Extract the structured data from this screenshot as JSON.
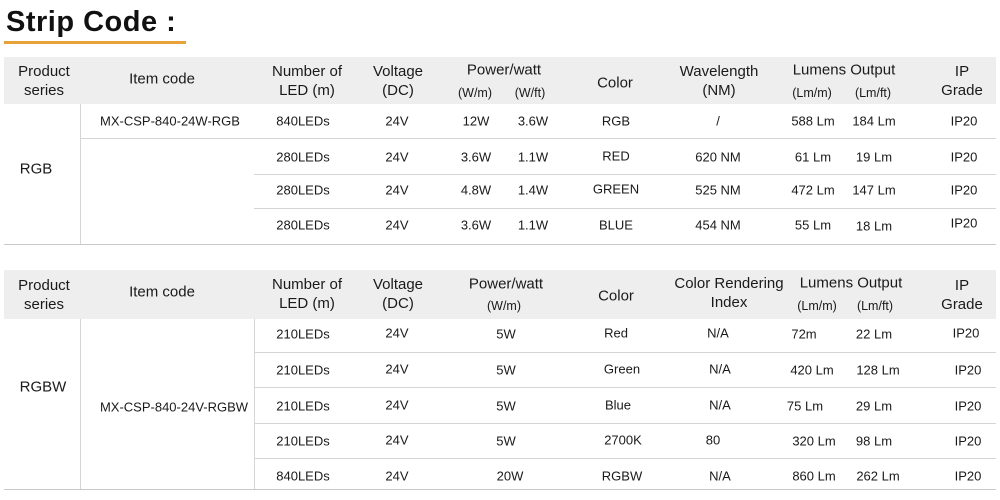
{
  "title": "Strip Code :",
  "table1": {
    "headers": {
      "product_series": [
        "Product",
        "series"
      ],
      "item_code": "Item code",
      "led": [
        "Number of",
        "LED (m)"
      ],
      "voltage": [
        "Voltage",
        "(DC)"
      ],
      "power": "Power/watt",
      "power_w_m": "(W/m)",
      "power_w_ft": "(W/ft)",
      "color": "Color",
      "wavelength": [
        "Wavelength",
        "(NM)"
      ],
      "lumens": "Lumens Output",
      "lumens_m": "(Lm/m)",
      "lumens_ft": "(Lm/ft)",
      "ip": [
        "IP",
        "Grade"
      ]
    },
    "series_name": "RGB",
    "item_code": "MX-CSP-840-24W-RGB",
    "rows": [
      {
        "led": "840LEDs",
        "voltage": "24V",
        "w_m": "12W",
        "w_ft": "3.6W",
        "color": "RGB",
        "wavelength": "/",
        "lm_m": "588 Lm",
        "lm_ft": "184 Lm",
        "ip": "IP20"
      },
      {
        "led": "280LEDs",
        "voltage": "24V",
        "w_m": "3.6W",
        "w_ft": "1.1W",
        "color": "RED",
        "wavelength": "620 NM",
        "lm_m": "61 Lm",
        "lm_ft": "19 Lm",
        "ip": "IP20"
      },
      {
        "led": "280LEDs",
        "voltage": "24V",
        "w_m": "4.8W",
        "w_ft": "1.4W",
        "color": "GREEN",
        "wavelength": "525 NM",
        "lm_m": "472 Lm",
        "lm_ft": "147 Lm",
        "ip": "IP20"
      },
      {
        "led": "280LEDs",
        "voltage": "24V",
        "w_m": "3.6W",
        "w_ft": "1.1W",
        "color": "BLUE",
        "wavelength": "454 NM",
        "lm_m": "55 Lm",
        "lm_ft": "18 Lm",
        "ip": "IP20"
      }
    ]
  },
  "table2": {
    "headers": {
      "product_series": [
        "Product",
        "series"
      ],
      "item_code": "Item code",
      "led": [
        "Number of",
        "LED (m)"
      ],
      "voltage": [
        "Voltage",
        "(DC)"
      ],
      "power": "Power/watt",
      "power_unit": "(W/m)",
      "color": "Color",
      "cri": [
        "Color Rendering",
        "Index"
      ],
      "lumens": "Lumens Output",
      "lumens_m": "(Lm/m)",
      "lumens_ft": "(Lm/ft)",
      "ip": [
        "IP",
        "Grade"
      ]
    },
    "series_name": "RGBW",
    "item_code": "MX-CSP-840-24V-RGBW",
    "rows": [
      {
        "led": "210LEDs",
        "voltage": "24V",
        "power": "5W",
        "color": "Red",
        "cri": "N/A",
        "lm_m": "72m",
        "lm_ft": "22 Lm",
        "ip": "IP20"
      },
      {
        "led": "210LEDs",
        "voltage": "24V",
        "power": "5W",
        "color": "Green",
        "cri": "N/A",
        "lm_m": "420 Lm",
        "lm_ft": "128 Lm",
        "ip": "IP20"
      },
      {
        "led": "210LEDs",
        "voltage": "24V",
        "power": "5W",
        "color": "Blue",
        "cri": "N/A",
        "lm_m": "75 Lm",
        "lm_ft": "29 Lm",
        "ip": "IP20"
      },
      {
        "led": "210LEDs",
        "voltage": "24V",
        "power": "5W",
        "color": "2700K",
        "cri": "80",
        "lm_m": "320 Lm",
        "lm_ft": "98 Lm",
        "ip": "IP20"
      },
      {
        "led": "840LEDs",
        "voltage": "24V",
        "power": "20W",
        "color": "RGBW",
        "cri": "N/A",
        "lm_m": "860 Lm",
        "lm_ft": "262 Lm",
        "ip": "IP20"
      }
    ]
  },
  "colors": {
    "title_underline": "#e8a23c",
    "header_bg": "#eeeeee"
  }
}
